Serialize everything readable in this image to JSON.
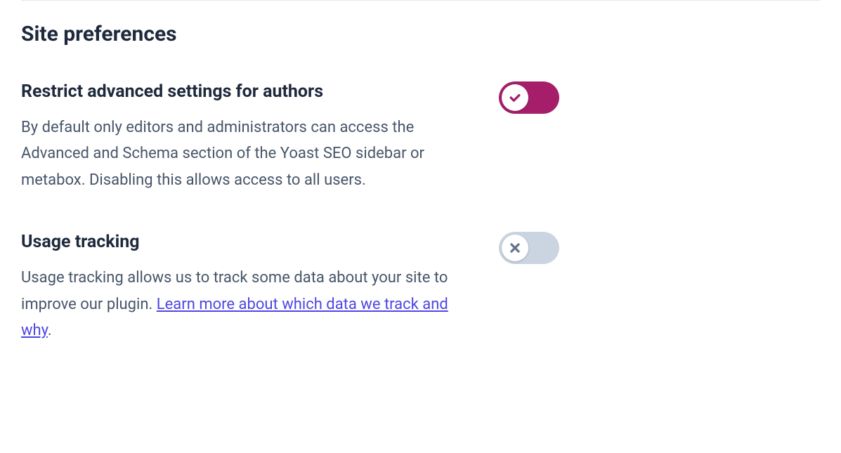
{
  "section": {
    "title": "Site preferences"
  },
  "settings": {
    "restrict": {
      "label": "Restrict advanced settings for authors",
      "description": "By default only editors and administrators can access the Advanced and Schema section of the Yoast SEO sidebar or metabox. Disabling this allows access to all users.",
      "enabled": true
    },
    "tracking": {
      "label": "Usage tracking",
      "description_pre": "Usage tracking allows us to track some data about your site to improve our plugin. ",
      "link_text": "Learn more about which data we track and why",
      "description_post": ".",
      "enabled": false
    }
  },
  "colors": {
    "toggle_on": "#a61e69",
    "toggle_off": "#cbd5e1",
    "link": "#4f46e5"
  }
}
